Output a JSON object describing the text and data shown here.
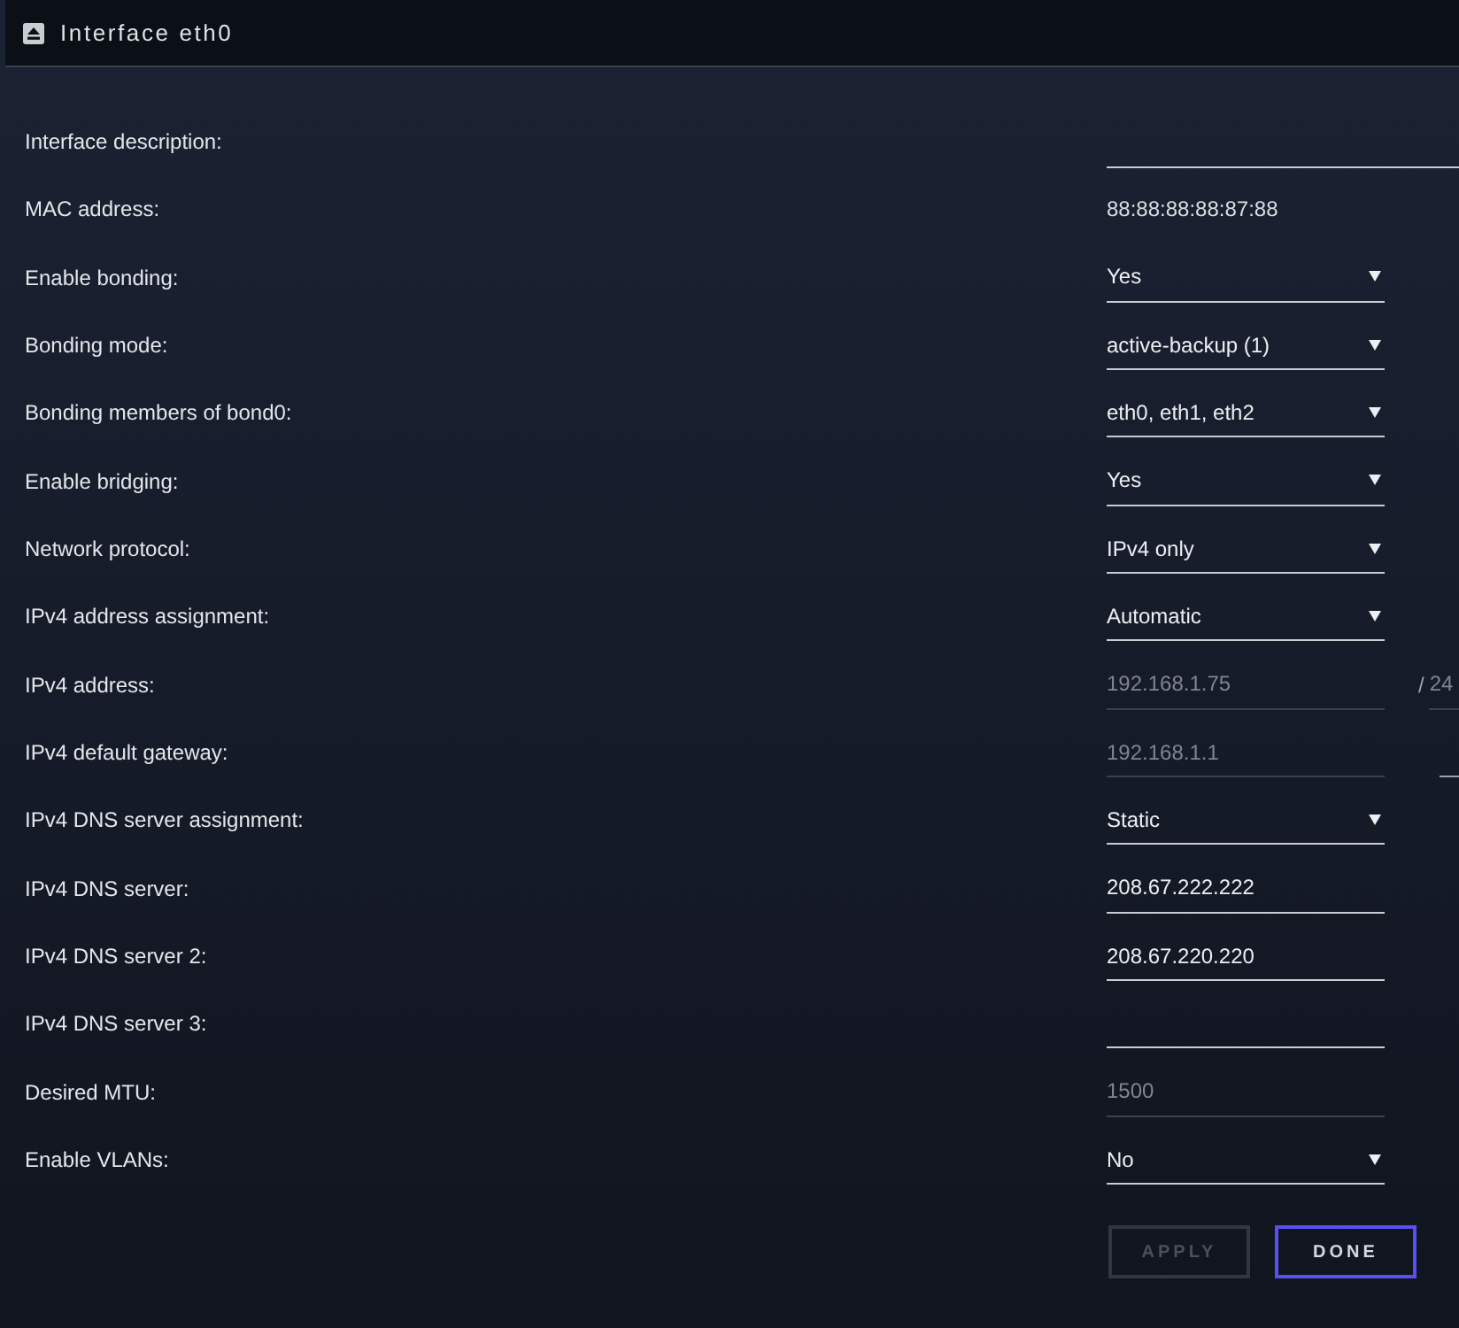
{
  "window": {
    "title": "Interface eth0"
  },
  "fields": [
    {
      "label": "Interface description:",
      "kind": "wide_input",
      "disabled": false
    },
    {
      "label": "MAC address:",
      "kind": "static",
      "value": "88:88:88:88:87:88"
    },
    {
      "label": "Enable bonding:",
      "kind": "select",
      "value": "Yes"
    },
    {
      "label": "Bonding mode:",
      "kind": "select",
      "value": "active-backup (1)"
    },
    {
      "label": "Bonding members of bond0:",
      "kind": "select",
      "value": "eth0, eth1, eth2"
    },
    {
      "label": "Enable bridging:",
      "kind": "select",
      "value": "Yes"
    },
    {
      "label": "Network protocol:",
      "kind": "select",
      "value": "IPv4 only"
    },
    {
      "label": "IPv4 address assignment:",
      "kind": "select",
      "value": "Automatic"
    },
    {
      "label": "IPv4 address:",
      "kind": "input",
      "value": "192.168.1.75",
      "disabled": true,
      "extra_field": {
        "separator": "/",
        "value": "24",
        "disabled": true
      }
    },
    {
      "label": "IPv4 default gateway:",
      "kind": "input",
      "value": "192.168.1.1",
      "disabled": true,
      "extra_field": {
        "disabled": false
      }
    },
    {
      "label": "IPv4 DNS server assignment:",
      "kind": "select",
      "value": "Static"
    },
    {
      "label": "IPv4 DNS server:",
      "kind": "input",
      "value": "208.67.222.222",
      "disabled": false
    },
    {
      "label": "IPv4 DNS server 2:",
      "kind": "input",
      "value": "208.67.220.220",
      "disabled": false
    },
    {
      "label": "IPv4 DNS server 3:",
      "kind": "input",
      "disabled": false
    },
    {
      "label": "Desired MTU:",
      "kind": "input",
      "value": "1500",
      "disabled": true
    },
    {
      "label": "Enable VLANs:",
      "kind": "select",
      "value": "No"
    }
  ],
  "buttons": [
    {
      "label": "APPLY",
      "disabled": true
    },
    {
      "label": "DONE",
      "disabled": false
    }
  ]
}
